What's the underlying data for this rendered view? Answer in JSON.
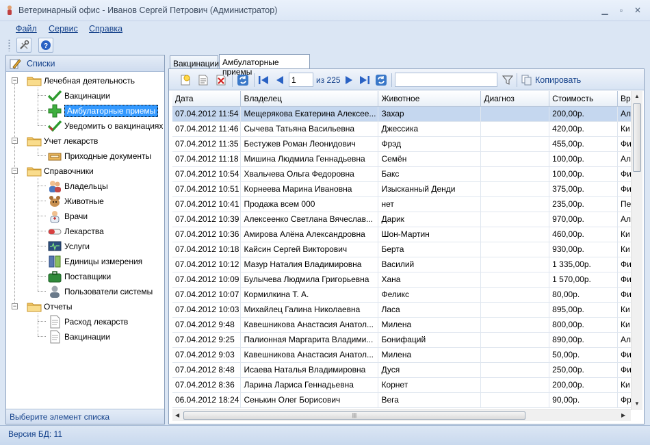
{
  "window": {
    "title": "Ветеринарный офис - Иванов Сергей Петрович (Администратор)"
  },
  "menu": [
    "Файл",
    "Сервис",
    "Справка"
  ],
  "left_panel": {
    "header": "Списки",
    "footer": "Выберите элемент списка",
    "tree": [
      {
        "label": "Лечебная деятельность",
        "icon": "folder-icon"
      },
      {
        "label": "Вакцинации",
        "icon": "checkmark-icon"
      },
      {
        "label": "Амбулаторные приемы",
        "icon": "medical-cross-icon",
        "selected": true
      },
      {
        "label": "Уведомить о вакцинациях",
        "icon": "checkmark-icon"
      },
      {
        "label": "Учет лекарств",
        "icon": "folder-icon"
      },
      {
        "label": "Приходные документы",
        "icon": "box-icon"
      },
      {
        "label": "Справочники",
        "icon": "folder-icon"
      },
      {
        "label": "Владельцы",
        "icon": "people-icon"
      },
      {
        "label": "Животные",
        "icon": "animal-icon"
      },
      {
        "label": "Врачи",
        "icon": "doctor-icon"
      },
      {
        "label": "Лекарства",
        "icon": "pill-icon"
      },
      {
        "label": "Услуги",
        "icon": "monitor-icon"
      },
      {
        "label": "Единицы измерения",
        "icon": "ruler-icon"
      },
      {
        "label": "Поставщики",
        "icon": "briefcase-icon"
      },
      {
        "label": "Пользователи системы",
        "icon": "user-icon"
      },
      {
        "label": "Отчеты",
        "icon": "folder-icon"
      },
      {
        "label": "Расход лекарств",
        "icon": "document-icon"
      },
      {
        "label": "Вакцинации",
        "icon": "document-icon"
      }
    ]
  },
  "tabs": [
    "Вакцинации",
    "Амбулаторные приемы"
  ],
  "grid_toolbar": {
    "page": "1",
    "page_of": "из 225",
    "copy_label": "Копировать",
    "filter": ""
  },
  "grid": {
    "columns": [
      "Дата",
      "Владелец",
      "Животное",
      "Диагноз",
      "Стоимость",
      "Вр"
    ],
    "rows": [
      [
        "07.04.2012 11:54",
        "Мещерякова Екатерина Алексее...",
        "Захар",
        "",
        "200,00р.",
        "Ал"
      ],
      [
        "07.04.2012 11:46",
        "Сычева Татьяна Васильевна",
        "Джессика",
        "",
        "420,00р.",
        "Ки"
      ],
      [
        "07.04.2012 11:35",
        "Бестужев Роман Леонидович",
        "Фрэд",
        "",
        "455,00р.",
        "Фи"
      ],
      [
        "07.04.2012 11:18",
        "Мишина Людмила Геннадьевна",
        "Семён",
        "",
        "100,00р.",
        "Ал"
      ],
      [
        "07.04.2012 10:54",
        "Хвальчева Ольга Федоровна",
        "Бакс",
        "",
        "100,00р.",
        "Фи"
      ],
      [
        "07.04.2012 10:51",
        "Корнеева Марина Ивановна",
        "Изысканный Денди",
        "",
        "375,00р.",
        "Фи"
      ],
      [
        "07.04.2012 10:41",
        "Продажа всем 000",
        "нет",
        "",
        "235,00р.",
        "Пе"
      ],
      [
        "07.04.2012 10:39",
        "Алексеенко Светлана Вячеслав...",
        "Дарик",
        "",
        "970,00р.",
        "Ал"
      ],
      [
        "07.04.2012 10:36",
        "Амирова Алёна Александровна",
        "Шон-Мартин",
        "",
        "460,00р.",
        "Ки"
      ],
      [
        "07.04.2012 10:18",
        "Кайсин Сергей Викторович",
        "Берта",
        "",
        "930,00р.",
        "Ки"
      ],
      [
        "07.04.2012 10:12",
        "Мазур Наталия Владимировна",
        "Василий",
        "",
        "1 335,00р.",
        "Фи"
      ],
      [
        "07.04.2012 10:09",
        "Булычева Людмила Григорьевна",
        "Хана",
        "",
        "1 570,00р.",
        "Фи"
      ],
      [
        "07.04.2012 10:07",
        "Кормилкина Т. А.",
        "Феликс",
        "",
        "80,00р.",
        "Фи"
      ],
      [
        "07.04.2012 10:03",
        "Михайлец Галина Николаевна",
        "Ласа",
        "",
        "895,00р.",
        "Ки"
      ],
      [
        "07.04.2012 9:48",
        "Кавешникова Анастасия Анатол...",
        "Милена",
        "",
        "800,00р.",
        "Ки"
      ],
      [
        "07.04.2012 9:25",
        "Палионная Маргарита Владими...",
        "Бонифаций",
        "",
        "890,00р.",
        "Ал"
      ],
      [
        "07.04.2012 9:03",
        "Кавешникова Анастасия Анатол...",
        "Милена",
        "",
        "50,00р.",
        "Фи"
      ],
      [
        "07.04.2012 8:48",
        "Исаева Наталья Владимировна",
        "Дуся",
        "",
        "250,00р.",
        "Фи"
      ],
      [
        "07.04.2012 8:36",
        "Ларина Лариса Геннадьевна",
        "Корнет",
        "",
        "200,00р.",
        "Ки"
      ],
      [
        "06.04.2012 18:24",
        "Сенькин Олег Борисович",
        "Вега",
        "",
        "90,00р.",
        "Фр"
      ]
    ]
  },
  "status": "Версия БД: 11"
}
